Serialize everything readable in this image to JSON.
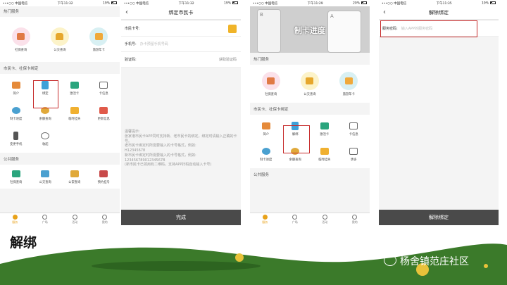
{
  "colors": {
    "accent": "#e8a21a",
    "highlight": "#c62b2b",
    "button": "#4a4a4a",
    "grass": "#3b7a2a"
  },
  "screens": [
    {
      "status": {
        "carrier": "•••○○ 中国电信",
        "time": "下午11:32",
        "battery": "19%"
      },
      "hot_title": "热门服务",
      "hot": [
        "社保查询",
        "公交查询",
        "旅游年卡"
      ],
      "card_title": "市民卡、社保卡绑定",
      "card": [
        "简介",
        "绑定",
        "激活卡",
        "卡信息",
        "制卡进度",
        "余额查询",
        "临时挂失",
        "更新信息",
        "变更手机",
        "收起"
      ],
      "public_title": "公共服务",
      "public": [
        "社保查询",
        "公交查询",
        "公安查询",
        "预约挂号"
      ],
      "tabs": [
        "服务",
        "广场",
        "活动",
        "我的"
      ]
    },
    {
      "status": {
        "carrier": "•••○○ 中国电信",
        "time": "下午11:32",
        "battery": "19%"
      },
      "title": "绑定市民卡",
      "card_no_label": "市民卡号:",
      "phone_label": "手机号:",
      "phone_placeholder": "办卡预留手机号码",
      "code_label": "验证码:",
      "code_action": "获取验证码",
      "tip": "温馨提示:\n张家港市民卡APP同时支持新、老市民卡的绑定，绑定时请输入正确的卡号。\n老市民卡绑定时所需要输入的卡号格式，例如:\nH12345678\n新市民卡绑定时所需要输入的卡号格式，例如:\n12345678901234567B\n(新市民卡已领用有二维码，支持APP扫码自动输入卡号)",
      "submit": "完成"
    },
    {
      "status": {
        "carrier": "•••○○ 中国电信",
        "time": "下午11:29",
        "battery": "20%"
      },
      "banner_text": "制卡进度",
      "banner_letters": [
        "B",
        "A"
      ],
      "hot_title": "热门服务",
      "hot": [
        "社保查询",
        "公交查询",
        "旅游年卡"
      ],
      "card_title": "市民卡、社保卡绑定",
      "card": [
        "简介",
        "解绑",
        "激活卡",
        "卡信息",
        "制卡进度",
        "余额查询",
        "临时挂失",
        "更多"
      ],
      "public_title": "公共服务",
      "tabs": [
        "服务",
        "广场",
        "活动",
        "我的"
      ]
    },
    {
      "status": {
        "carrier": "•••○○ 中国电信",
        "time": "下午11:35",
        "battery": "19%"
      },
      "title": "解除绑定",
      "pwd_label": "服务密码:",
      "pwd_placeholder": "输入APP的服务密码",
      "submit": "解除绑定"
    }
  ],
  "caption": "解绑",
  "watermark": "杨舍镇范庄社区"
}
